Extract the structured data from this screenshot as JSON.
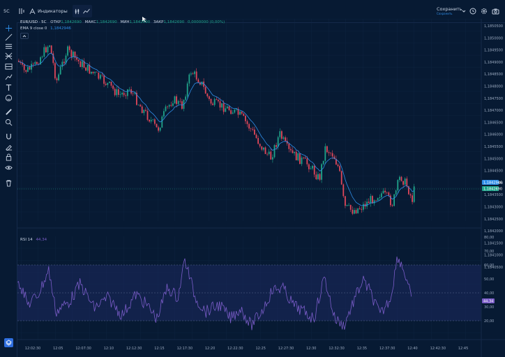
{
  "topbar": {
    "symbol_short": "5C",
    "indicators_label": "Индикаторы",
    "save_label": "Сохранить",
    "save_sub": "Сохранить"
  },
  "legend": {
    "symbol": "EUR/USD · 5C",
    "open_label": "ОТКР",
    "open_value": "1,1842690",
    "high_label": "МАКС",
    "high_value": "1,1842690",
    "low_label": "МИН",
    "low_value": "1,1842690",
    "close_label": "ЗАКР",
    "close_value": "1,1842690",
    "change_value": "0,0000000 (0,00%)",
    "ema_label": "EMA 9 close 0",
    "ema_value": "1,1842946"
  },
  "rsi": {
    "label": "RSI 14",
    "value": "44,34"
  },
  "price_axis": {
    "ticks": [
      "1,1850500",
      "1,1850000",
      "1,1849500",
      "1,1849000",
      "1,1848500",
      "1,1848000",
      "1,1847500",
      "1,1847000",
      "1,1846500",
      "1,1846000",
      "1,1845500",
      "1,1845000",
      "1,1844500",
      "1,1844000",
      "1,1843500",
      "1,1843000",
      "1,1842500",
      "1,1842000",
      "1,1841500",
      "1,1841000",
      "1,1840500"
    ],
    "ema_badge": "1,1842946",
    "price_badge": "1,1842690"
  },
  "rsi_axis": {
    "ticks": [
      "80,00",
      "70,00",
      "60,00",
      "50,00",
      "40,00",
      "30,00",
      "20,00"
    ],
    "badge": "44,34"
  },
  "time_axis": {
    "ticks": [
      "12:02:30",
      "12:05",
      "12:07:30",
      "12:10",
      "12:12:30",
      "12:15",
      "12:17:30",
      "12:20",
      "12:22:30",
      "12:25",
      "12:27:30",
      "12:30",
      "12:32:30",
      "12:35",
      "12:37:30",
      "12:40",
      "12:42:30",
      "12:45"
    ]
  },
  "colors": {
    "up": "#1fa38a",
    "down": "#e0475a",
    "ema": "#2f8ee8",
    "rsi": "#7a5cc8",
    "background": "#071a33"
  },
  "icons": [
    "crosshair-icon",
    "trendline-icon",
    "horizontal-lines-icon",
    "pitchfork-icon",
    "channel-icon",
    "path-icon",
    "text-icon",
    "emoji-icon",
    "ruler-icon",
    "zoom-icon",
    "magnet-icon",
    "lock-drawings-icon",
    "lock-icon",
    "eye-icon",
    "trash-icon"
  ]
}
